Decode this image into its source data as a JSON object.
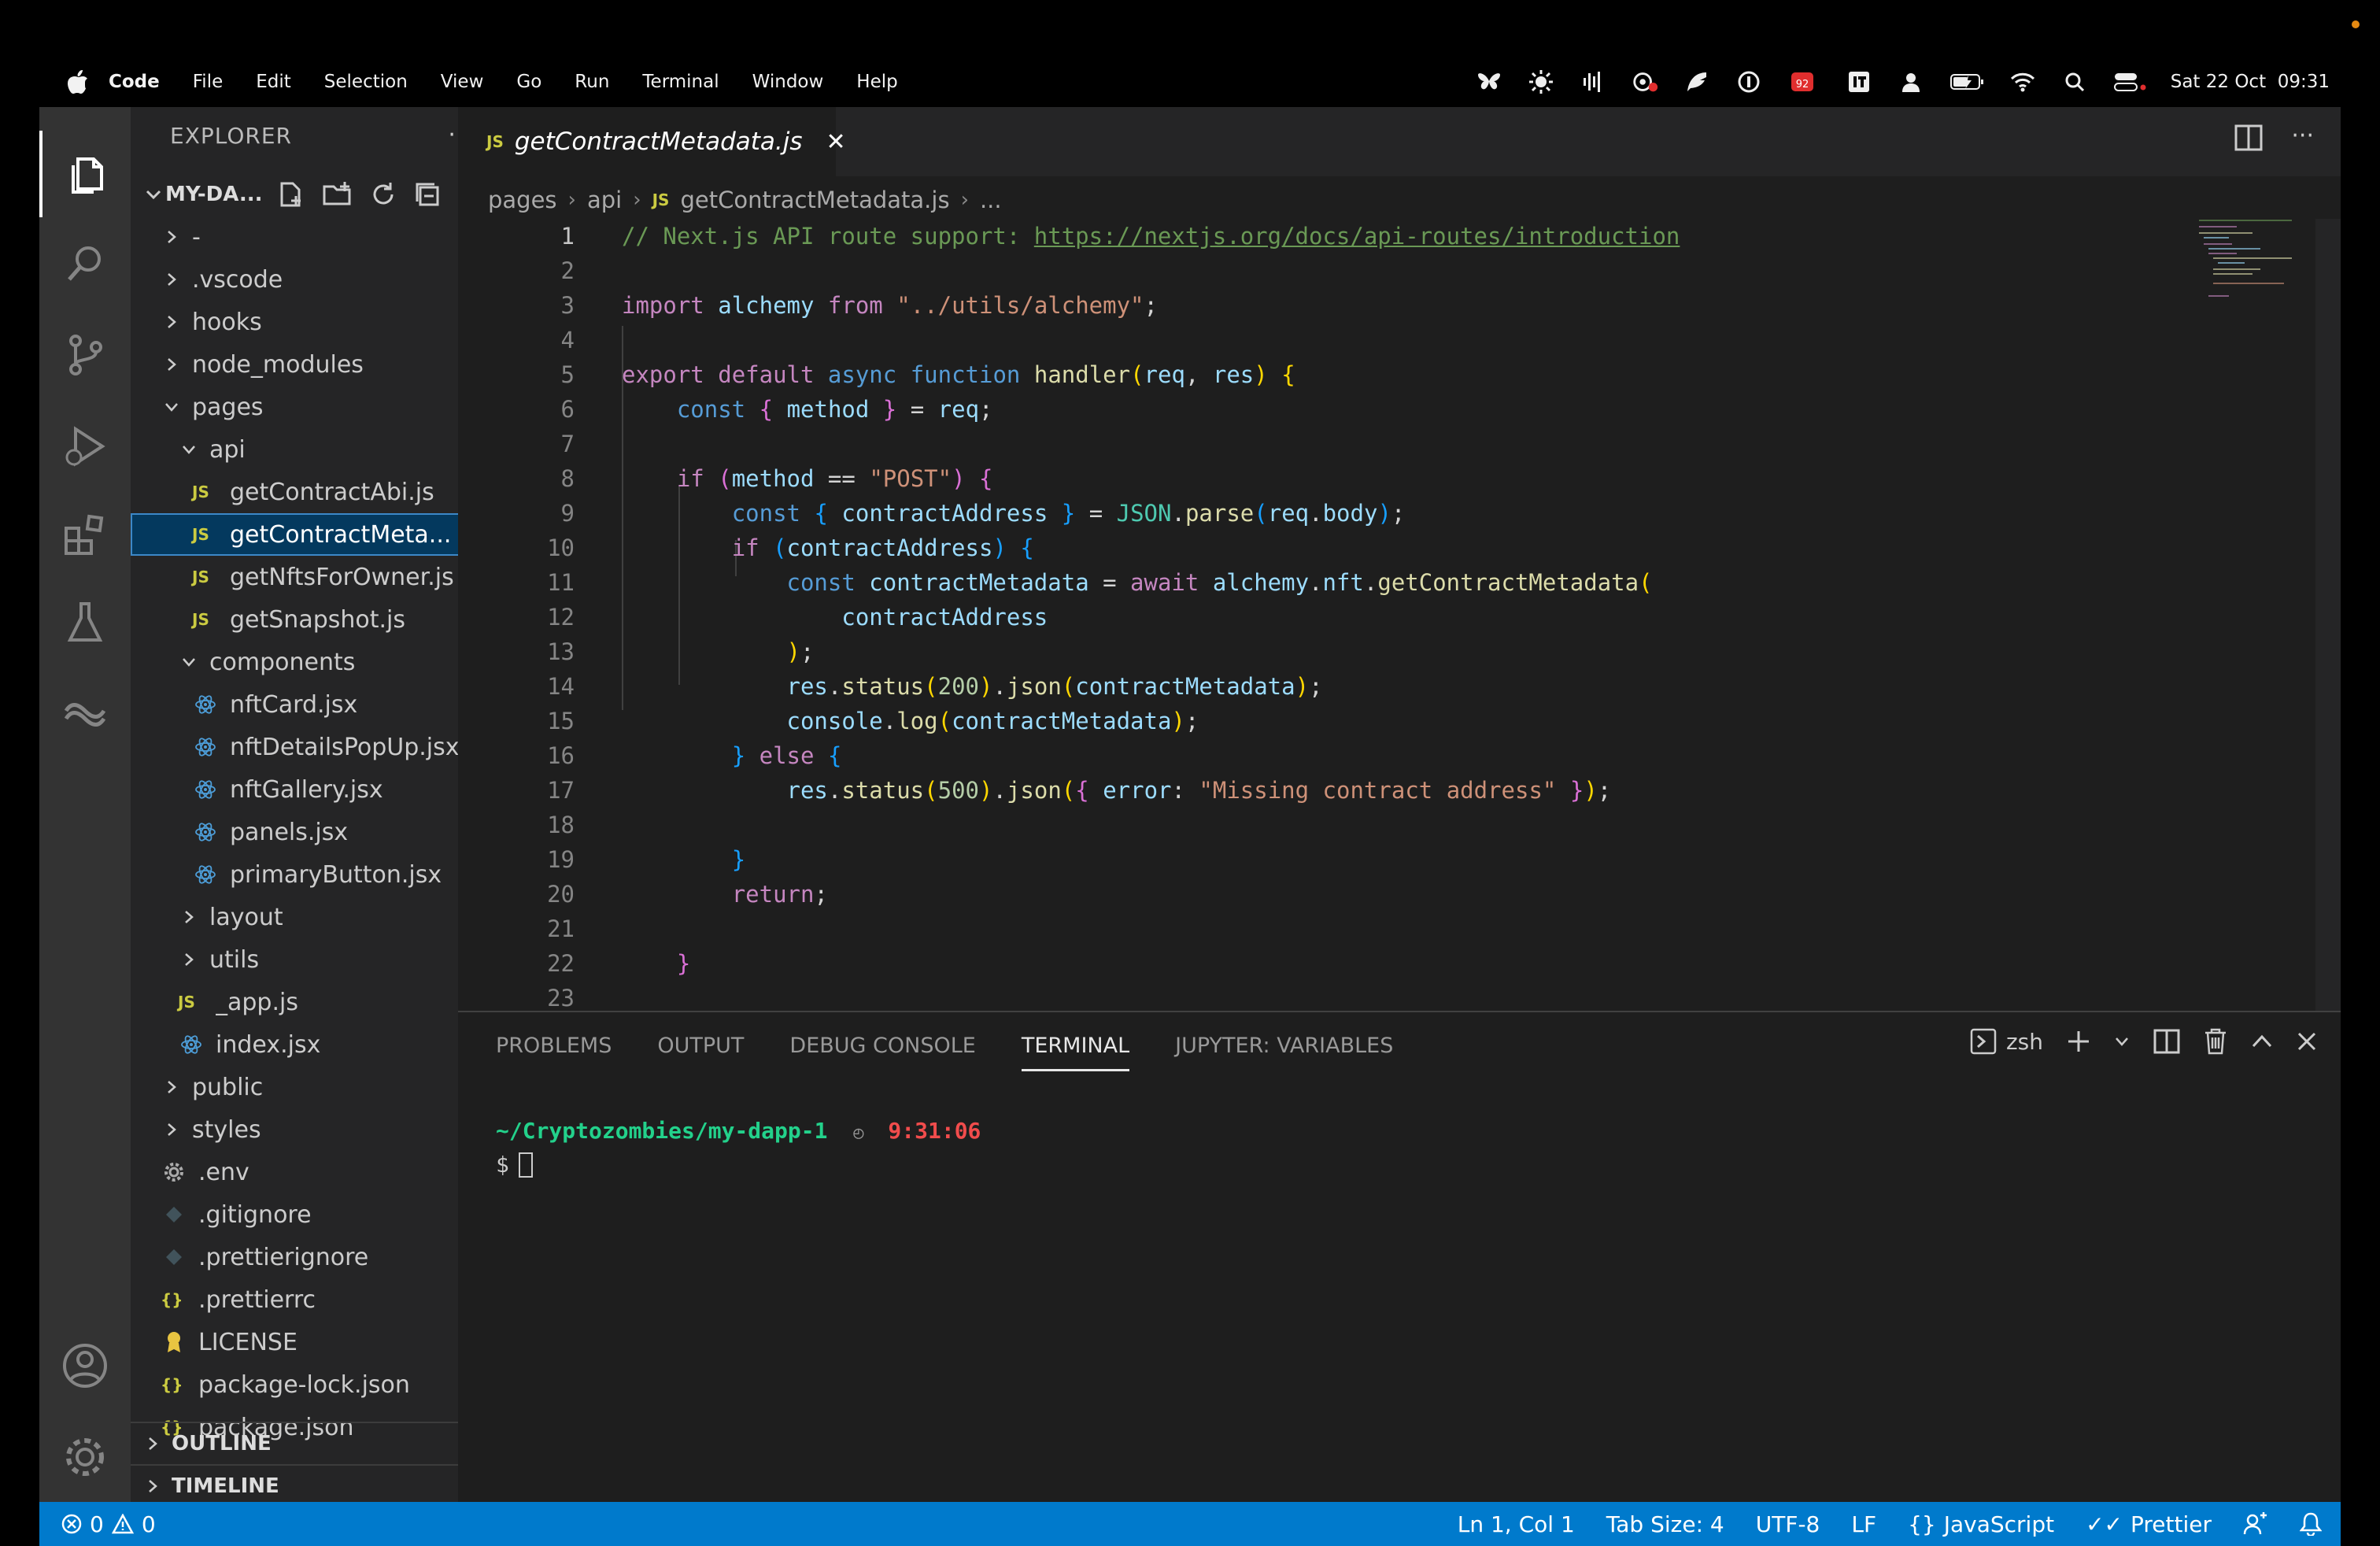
{
  "menubar": {
    "items": [
      "Code",
      "File",
      "Edit",
      "Selection",
      "View",
      "Go",
      "Run",
      "Terminal",
      "Window",
      "Help"
    ],
    "clock": "Sat 22 Oct  09:31",
    "badge": "92"
  },
  "explorer": {
    "title": "EXPLORER",
    "more": "···",
    "folder": "MY-DA...",
    "outline": "OUTLINE",
    "timeline": "TIMELINE",
    "tree": [
      {
        "label": "-",
        "type": "folder",
        "depth": 0
      },
      {
        "label": ".vscode",
        "type": "folder",
        "depth": 0
      },
      {
        "label": "hooks",
        "type": "folder",
        "depth": 0
      },
      {
        "label": "node_modules",
        "type": "folder",
        "depth": 0
      },
      {
        "label": "pages",
        "type": "folder-open",
        "depth": 0
      },
      {
        "label": "api",
        "type": "folder-open",
        "depth": 1
      },
      {
        "label": "getContractAbi.js",
        "type": "js",
        "depth": 2
      },
      {
        "label": "getContractMeta...",
        "type": "js",
        "depth": 2,
        "selected": true
      },
      {
        "label": "getNftsForOwner.js",
        "type": "js",
        "depth": 2
      },
      {
        "label": "getSnapshot.js",
        "type": "js",
        "depth": 2
      },
      {
        "label": "components",
        "type": "folder-open",
        "depth": 1
      },
      {
        "label": "nftCard.jsx",
        "type": "react",
        "depth": 2
      },
      {
        "label": "nftDetailsPopUp.jsx",
        "type": "react",
        "depth": 2
      },
      {
        "label": "nftGallery.jsx",
        "type": "react",
        "depth": 2
      },
      {
        "label": "panels.jsx",
        "type": "react",
        "depth": 2
      },
      {
        "label": "primaryButton.jsx",
        "type": "react",
        "depth": 2
      },
      {
        "label": "layout",
        "type": "folder",
        "depth": 1
      },
      {
        "label": "utils",
        "type": "folder",
        "depth": 1
      },
      {
        "label": "_app.js",
        "type": "js",
        "depth": 1
      },
      {
        "label": "index.jsx",
        "type": "react",
        "depth": 1
      },
      {
        "label": "public",
        "type": "folder",
        "depth": 0
      },
      {
        "label": "styles",
        "type": "folder",
        "depth": 0
      },
      {
        "label": ".env",
        "type": "gear",
        "depth": 0
      },
      {
        "label": ".gitignore",
        "type": "diamond",
        "depth": 0
      },
      {
        "label": ".prettierignore",
        "type": "diamond",
        "depth": 0
      },
      {
        "label": ".prettierrc",
        "type": "json",
        "depth": 0
      },
      {
        "label": "LICENSE",
        "type": "license",
        "depth": 0
      },
      {
        "label": "package-lock.json",
        "type": "json",
        "depth": 0
      },
      {
        "label": "package.json",
        "type": "json",
        "depth": 0
      }
    ]
  },
  "editor": {
    "tab": "getContractMetadata.js",
    "js_badge": "JS",
    "breadcrumb": [
      "pages",
      "api",
      "getContractMetadata.js",
      "..."
    ],
    "current_line": 1
  },
  "panel": {
    "tabs": [
      "PROBLEMS",
      "OUTPUT",
      "DEBUG CONSOLE",
      "TERMINAL",
      "JUPYTER: VARIABLES"
    ],
    "active_tab": "TERMINAL",
    "shell": "zsh",
    "terminal_path": "~/Cryptozombies/my-dapp-1",
    "terminal_time": "9:31:06",
    "prompt": "$"
  },
  "statusbar": {
    "errors": "0",
    "warnings": "0",
    "position": "Ln 1, Col 1",
    "tab_size": "Tab Size: 4",
    "encoding": "UTF-8",
    "eol": "LF",
    "language": "JavaScript",
    "formatter": "Prettier"
  }
}
